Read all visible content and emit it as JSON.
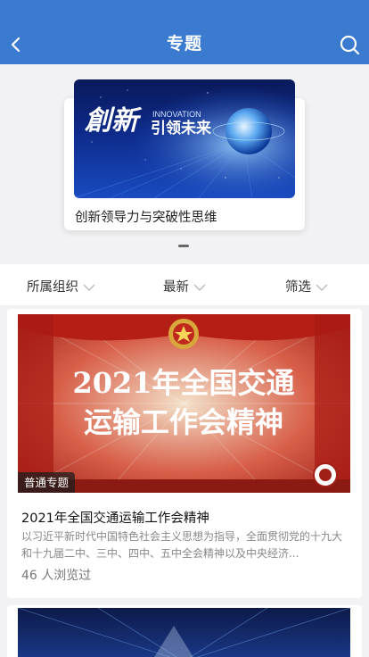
{
  "header": {
    "title": "专题"
  },
  "banner": {
    "caption": "创新领导力与突破性思维",
    "image_text_main": "創新",
    "image_text_en": "INNOVATION",
    "image_text_cn": "引领未来"
  },
  "filters": [
    {
      "label": "所属组织"
    },
    {
      "label": "最新"
    },
    {
      "label": "筛选"
    }
  ],
  "topics": [
    {
      "image_line1": "2021年全国交通",
      "image_line2": "运输工作会精神",
      "badge": "普通专题",
      "title": "2021年全国交通运输工作会精神",
      "description": "以习近平新时代中国特色社会主义思想为指导，全面贯彻党的十九大和十九届二中、三中、四中、五中全会精神以及中央经济...",
      "views": "46 人浏览过"
    }
  ],
  "colors": {
    "header": "#3a7bd0",
    "page_bg": "#f2f2f4",
    "card_red": "#c0342a"
  }
}
